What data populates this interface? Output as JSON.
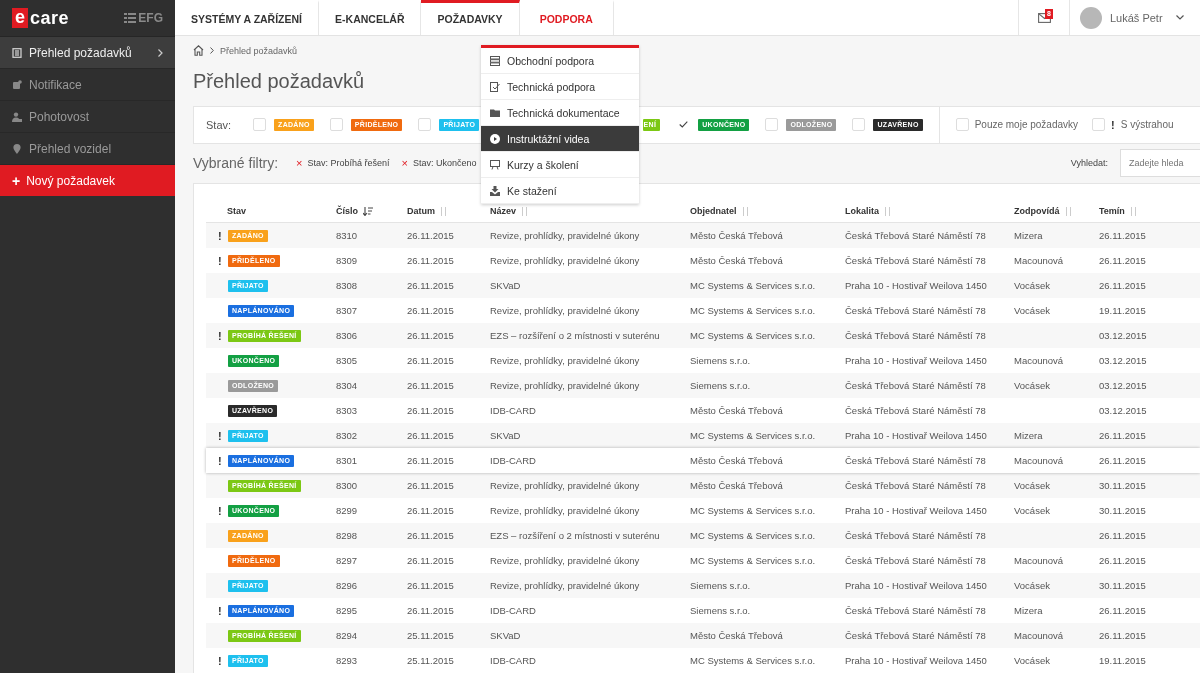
{
  "logo": {
    "mark": "e",
    "text": "care",
    "partner": "EFG"
  },
  "sidebar": {
    "items": [
      {
        "label": "Přehled požadavků",
        "kind": "nav",
        "selected": true
      },
      {
        "label": "Notifikace",
        "kind": "nav",
        "selected": false
      },
      {
        "label": "Pohotovost",
        "kind": "nav",
        "selected": false
      },
      {
        "label": "Přehled vozidel",
        "kind": "nav",
        "selected": false
      },
      {
        "label": "Nový požadavek",
        "kind": "action",
        "sign": "+",
        "selected": false
      }
    ]
  },
  "top_nav": {
    "tabs": [
      {
        "label": "SYSTÉMY A ZAŘÍZENÍ",
        "selected": false,
        "open": false
      },
      {
        "label": "E-KANCELÁŘ",
        "selected": false,
        "open": false
      },
      {
        "label": "POŽADAVKY",
        "selected": true,
        "open": false
      },
      {
        "label": "PODPORA",
        "selected": false,
        "open": true
      }
    ],
    "messages_badge": "8",
    "user": {
      "name": "Lukáš Petr"
    }
  },
  "dropdown": {
    "items": [
      {
        "label": "Obchodní podpora",
        "selected": false
      },
      {
        "label": "Technická podpora",
        "selected": false
      },
      {
        "label": "Technická dokumentace",
        "selected": false
      },
      {
        "label": "Instruktážní videa",
        "selected": true
      },
      {
        "label": "Kurzy a školení",
        "selected": false
      },
      {
        "label": "Ke stažení",
        "selected": false
      }
    ]
  },
  "breadcrumb": {
    "current": "Přehled požadavků"
  },
  "page_title": "Přehled požadavků",
  "filter_bar": {
    "label": "Stav:",
    "statuses": [
      {
        "label": "ZADÁNO",
        "kind": "zadano",
        "checked": false
      },
      {
        "label": "PŘIDĚLENO",
        "kind": "prideleno",
        "checked": false
      },
      {
        "label": "PŘIJATO",
        "kind": "prijato",
        "checked": false
      }
    ],
    "covered_chip": {
      "label": "ENÍ",
      "kind": "probiha"
    },
    "statuses_after": [
      {
        "label": "UKONČENO",
        "kind": "ukonceno",
        "checked": true
      },
      {
        "label": "ODLOŽENO",
        "kind": "odlozeno",
        "checked": false
      },
      {
        "label": "UZAVŘENO",
        "kind": "uzavreno",
        "checked": false
      }
    ],
    "options": [
      {
        "label": "Pouze moje požadavky",
        "checked": false
      },
      {
        "label": "S výstrahou",
        "warn_sign": "!",
        "checked": false
      }
    ]
  },
  "selected_filters": {
    "label": "Vybrané filtry:",
    "chips": [
      {
        "remove": "×",
        "label": "Stav: Probíhá řešení"
      },
      {
        "remove": "×",
        "label": "Stav: Ukončeno"
      }
    ]
  },
  "search": {
    "label": "Vyhledat:",
    "placeholder": "Zadejte hleda"
  },
  "table": {
    "columns": [
      {
        "label": "Stav",
        "kind": "plain"
      },
      {
        "label": "Číslo",
        "kind": "sortable",
        "sorted": true
      },
      {
        "label": "Datum",
        "kind": "sortable",
        "sorted": false
      },
      {
        "label": "Název",
        "kind": "sortable",
        "sorted": false
      },
      {
        "label": "Objednatel",
        "kind": "sortable",
        "sorted": false
      },
      {
        "label": "Lokalita",
        "kind": "sortable",
        "sorted": false
      },
      {
        "label": "Zodpovídá",
        "kind": "sortable",
        "sorted": false
      },
      {
        "label": "Temín",
        "kind": "sortable",
        "sorted": false
      }
    ],
    "rows": [
      {
        "warning": "!",
        "kind": "zadano",
        "status_label": "ZADÁNO",
        "number": "8310",
        "date": "26.11.2015",
        "name": "Revize, prohlídky, pravidelné úkony",
        "customer": "Město Česká Třebová",
        "location": "Česká Třebová Staré Náměstí 78",
        "responsible": "Mizera",
        "deadline": "26.11.2015",
        "highlighted": false
      },
      {
        "warning": "!",
        "kind": "prideleno",
        "status_label": "PŘIDĚLENO",
        "number": "8309",
        "date": "26.11.2015",
        "name": "Revize, prohlídky, pravidelné úkony",
        "customer": "Město Česká Třebová",
        "location": "Česká Třebová Staré Náměstí 78",
        "responsible": "Macounová",
        "deadline": "26.11.2015",
        "highlighted": false
      },
      {
        "kind": "prijato",
        "status_label": "PŘIJATO",
        "number": "8308",
        "date": "26.11.2015",
        "name": "SKVaD",
        "customer": "MC Systems & Services s.r.o.",
        "location": "Praha 10 - Hostivař Weilova 1450",
        "responsible": "Vocásek",
        "deadline": "26.11.2015",
        "highlighted": false
      },
      {
        "kind": "naplanovano",
        "status_label": "NAPLÁNOVÁNO",
        "number": "8307",
        "date": "26.11.2015",
        "name": "Revize, prohlídky, pravidelné úkony",
        "customer": "MC Systems & Services s.r.o.",
        "location": "Česká Třebová Staré Náměstí 78",
        "responsible": "Vocásek",
        "deadline": "19.11.2015",
        "highlighted": false
      },
      {
        "warning": "!",
        "kind": "probiha",
        "status_label": "PROBÍHÁ ŘEŠENÍ",
        "number": "8306",
        "date": "26.11.2015",
        "name": "EZS – rozšíření o 2 místnosti v suterénu",
        "customer": "MC Systems & Services s.r.o.",
        "location": "Česká Třebová Staré Náměstí 78",
        "deadline": "03.12.2015",
        "highlighted": false
      },
      {
        "kind": "ukonceno",
        "status_label": "UKONČENO",
        "number": "8305",
        "date": "26.11.2015",
        "name": "Revize, prohlídky, pravidelné úkony",
        "customer": "Siemens s.r.o.",
        "location": "Praha 10 - Hostivař Weilova 1450",
        "responsible": "Macounová",
        "deadline": "03.12.2015",
        "highlighted": false
      },
      {
        "kind": "odlozeno",
        "status_label": "ODLOŽENO",
        "number": "8304",
        "date": "26.11.2015",
        "name": "Revize, prohlídky, pravidelné úkony",
        "customer": "Siemens s.r.o.",
        "location": "Česká Třebová Staré Náměstí 78",
        "responsible": "Vocásek",
        "deadline": "03.12.2015",
        "highlighted": false
      },
      {
        "kind": "uzavreno",
        "status_label": "UZAVŘENO",
        "number": "8303",
        "date": "26.11.2015",
        "name": "IDB-CARD",
        "customer": "Město Česká Třebová",
        "location": "Česká Třebová Staré Náměstí 78",
        "deadline": "03.12.2015",
        "highlighted": false
      },
      {
        "warning": "!",
        "kind": "prijato",
        "status_label": "PŘIJATO",
        "number": "8302",
        "date": "26.11.2015",
        "name": "SKVaD",
        "customer": "MC Systems & Services s.r.o.",
        "location": "Praha 10 - Hostivař Weilova 1450",
        "responsible": "Mizera",
        "deadline": "26.11.2015",
        "highlighted": false
      },
      {
        "warning": "!",
        "kind": "naplanovano",
        "status_label": "NAPLÁNOVÁNO",
        "number": "8301",
        "date": "26.11.2015",
        "name": "IDB-CARD",
        "customer": "Město Česká Třebová",
        "location": "Česká Třebová Staré Náměstí 78",
        "responsible": "Macounová",
        "deadline": "26.11.2015",
        "highlighted": true
      },
      {
        "kind": "probiha",
        "status_label": "PROBÍHÁ ŘEŠENÍ",
        "number": "8300",
        "date": "26.11.2015",
        "name": "Revize, prohlídky, pravidelné úkony",
        "customer": "Město Česká Třebová",
        "location": "Česká Třebová Staré Náměstí 78",
        "responsible": "Vocásek",
        "deadline": "30.11.2015",
        "highlighted": false
      },
      {
        "warning": "!",
        "kind": "ukonceno",
        "status_label": "UKONČENO",
        "number": "8299",
        "date": "26.11.2015",
        "name": "Revize, prohlídky, pravidelné úkony",
        "customer": "MC Systems & Services s.r.o.",
        "location": "Praha 10 - Hostivař Weilova 1450",
        "responsible": "Vocásek",
        "deadline": "30.11.2015",
        "highlighted": false
      },
      {
        "kind": "zadano",
        "status_label": "ZADÁNO",
        "number": "8298",
        "date": "26.11.2015",
        "name": "EZS – rozšíření o 2 místnosti v suterénu",
        "customer": "MC Systems & Services s.r.o.",
        "location": "Česká Třebová Staré Náměstí 78",
        "deadline": "26.11.2015",
        "highlighted": false
      },
      {
        "kind": "prideleno",
        "status_label": "PŘIDĚLENO",
        "number": "8297",
        "date": "26.11.2015",
        "name": "Revize, prohlídky, pravidelné úkony",
        "customer": "MC Systems & Services s.r.o.",
        "location": "Česká Třebová Staré Náměstí 78",
        "responsible": "Macounová",
        "deadline": "26.11.2015",
        "highlighted": false
      },
      {
        "kind": "prijato",
        "status_label": "PŘIJATO",
        "number": "8296",
        "date": "26.11.2015",
        "name": "Revize, prohlídky, pravidelné úkony",
        "customer": "Siemens s.r.o.",
        "location": "Praha 10 - Hostivař Weilova 1450",
        "responsible": "Vocásek",
        "deadline": "30.11.2015",
        "highlighted": false
      },
      {
        "warning": "!",
        "kind": "naplanovano",
        "status_label": "NAPLÁNOVÁNO",
        "number": "8295",
        "date": "26.11.2015",
        "name": "IDB-CARD",
        "customer": "Siemens s.r.o.",
        "location": "Česká Třebová Staré Náměstí 78",
        "responsible": "Mizera",
        "deadline": "26.11.2015",
        "highlighted": false
      },
      {
        "kind": "probiha",
        "status_label": "PROBÍHÁ ŘEŠENÍ",
        "number": "8294",
        "date": "25.11.2015",
        "name": "SKVaD",
        "customer": "Město Česká Třebová",
        "location": "Česká Třebová Staré Náměstí 78",
        "responsible": "Macounová",
        "deadline": "26.11.2015",
        "highlighted": false
      },
      {
        "warning": "!",
        "kind": "prijato",
        "status_label": "PŘIJATO",
        "number": "8293",
        "date": "25.11.2015",
        "name": "IDB-CARD",
        "customer": "MC Systems & Services s.r.o.",
        "location": "Praha 10 - Hostivař Weilova 1450",
        "responsible": "Vocásek",
        "deadline": "19.11.2015",
        "highlighted": false
      }
    ]
  }
}
